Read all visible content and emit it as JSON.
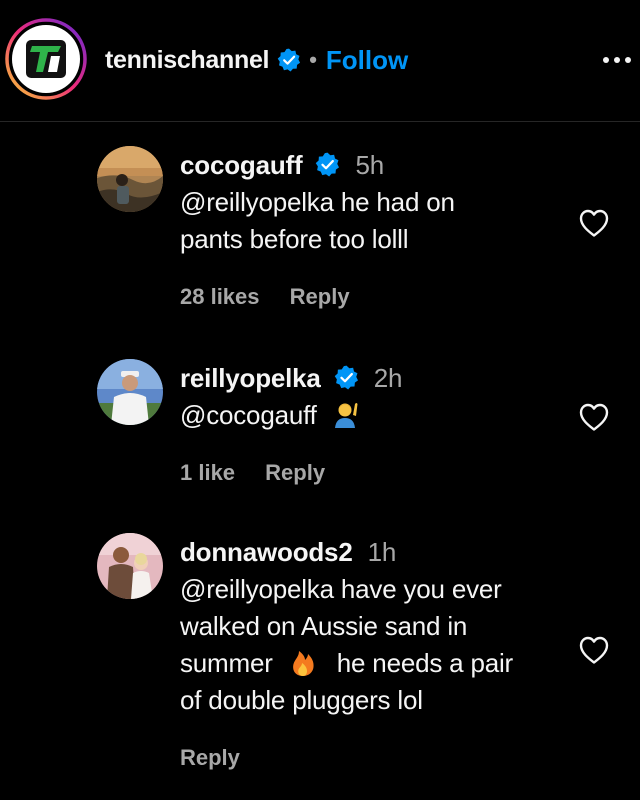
{
  "header": {
    "username": "tennischannel",
    "separator": "•",
    "follow_label": "Follow"
  },
  "comments": [
    {
      "username": "cocogauff",
      "time": "5h",
      "verified": true,
      "lines": [
        "@reillyopelka he had on",
        "pants before too lolll"
      ],
      "likes": "28 likes",
      "reply": "Reply"
    },
    {
      "username": "reillyopelka",
      "time": "2h",
      "verified": true,
      "lines": [
        "@cocogauff"
      ],
      "emoji": "person-raising-hand-emoji",
      "likes": "1 like",
      "reply": "Reply"
    },
    {
      "username": "donnawoods2",
      "time": "1h",
      "verified": false,
      "lines": [
        "@reillyopelka have you ever",
        "walked on Aussie sand in",
        "summer",
        "he needs a pair",
        "of double pluggers lol"
      ],
      "emoji": "fire-emoji",
      "reply": "Reply"
    }
  ],
  "colors": {
    "background": "#000000",
    "text": "#f5f5f5",
    "secondary": "#a8a8a8",
    "link": "#0095f6",
    "verified": "#0095f6"
  },
  "icons": {
    "verified": "verified-badge-icon",
    "heart": "heart-icon",
    "more": "more-options-icon"
  }
}
